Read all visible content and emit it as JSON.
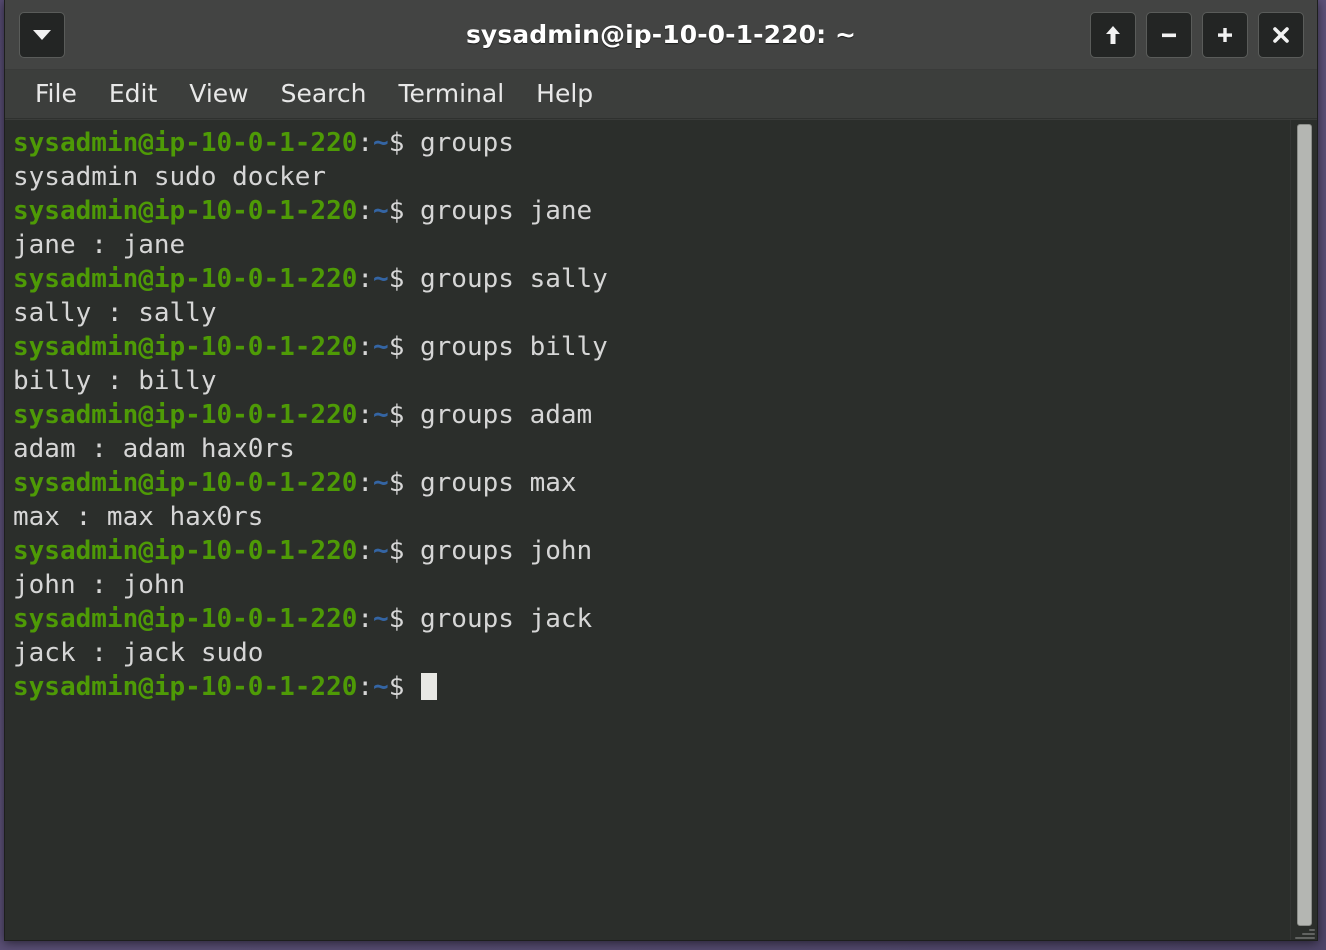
{
  "window": {
    "title": "sysadmin@ip-10-0-1-220: ~",
    "menu_button_icon": "chevron-down-icon",
    "buttons": [
      {
        "name": "shade-button",
        "icon": "arrow-up-icon",
        "glyph": "↑"
      },
      {
        "name": "minimize-button",
        "icon": "minus-icon",
        "glyph": "−"
      },
      {
        "name": "maximize-button",
        "icon": "plus-icon",
        "glyph": "+"
      },
      {
        "name": "close-button",
        "icon": "close-icon",
        "glyph": "✕"
      }
    ]
  },
  "menubar": {
    "items": [
      {
        "label": "File"
      },
      {
        "label": "Edit"
      },
      {
        "label": "View"
      },
      {
        "label": "Search"
      },
      {
        "label": "Terminal"
      },
      {
        "label": "Help"
      }
    ]
  },
  "terminal": {
    "prompt": {
      "user_host": "sysadmin@ip-10-0-1-220",
      "colon": ":",
      "path": "~",
      "sigil": "$"
    },
    "lines": [
      {
        "type": "prompt",
        "command": "groups"
      },
      {
        "type": "output",
        "text": "sysadmin sudo docker"
      },
      {
        "type": "prompt",
        "command": "groups jane"
      },
      {
        "type": "output",
        "text": "jane : jane"
      },
      {
        "type": "prompt",
        "command": "groups sally"
      },
      {
        "type": "output",
        "text": "sally : sally"
      },
      {
        "type": "prompt",
        "command": "groups billy"
      },
      {
        "type": "output",
        "text": "billy : billy"
      },
      {
        "type": "prompt",
        "command": "groups adam"
      },
      {
        "type": "output",
        "text": "adam : adam hax0rs"
      },
      {
        "type": "prompt",
        "command": "groups max"
      },
      {
        "type": "output",
        "text": "max : max hax0rs"
      },
      {
        "type": "prompt",
        "command": "groups john"
      },
      {
        "type": "output",
        "text": "john : john"
      },
      {
        "type": "prompt",
        "command": "groups jack"
      },
      {
        "type": "output",
        "text": "jack : jack sudo"
      },
      {
        "type": "prompt",
        "command": "",
        "cursor": true
      }
    ]
  },
  "colors": {
    "terminal_background": "#2b2e2b",
    "window_chrome": "#434443",
    "menubar_background": "#3c3e3c",
    "prompt_user_host": "#4e9a06",
    "prompt_path": "#3465a4",
    "foreground": "#d6d6d6",
    "cursor": "#e8e8e4",
    "scrollbar_thumb": "#b4b6b2",
    "desktop": "#5b5078"
  }
}
